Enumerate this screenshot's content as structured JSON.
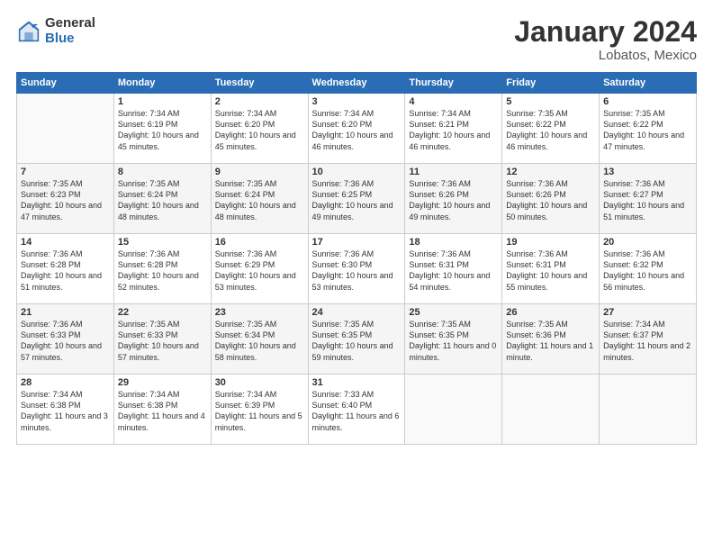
{
  "logo": {
    "general": "General",
    "blue": "Blue"
  },
  "title": "January 2024",
  "subtitle": "Lobatos, Mexico",
  "days_header": [
    "Sunday",
    "Monday",
    "Tuesday",
    "Wednesday",
    "Thursday",
    "Friday",
    "Saturday"
  ],
  "weeks": [
    [
      {
        "num": "",
        "sunrise": "",
        "sunset": "",
        "daylight": ""
      },
      {
        "num": "1",
        "sunrise": "Sunrise: 7:34 AM",
        "sunset": "Sunset: 6:19 PM",
        "daylight": "Daylight: 10 hours and 45 minutes."
      },
      {
        "num": "2",
        "sunrise": "Sunrise: 7:34 AM",
        "sunset": "Sunset: 6:20 PM",
        "daylight": "Daylight: 10 hours and 45 minutes."
      },
      {
        "num": "3",
        "sunrise": "Sunrise: 7:34 AM",
        "sunset": "Sunset: 6:20 PM",
        "daylight": "Daylight: 10 hours and 46 minutes."
      },
      {
        "num": "4",
        "sunrise": "Sunrise: 7:34 AM",
        "sunset": "Sunset: 6:21 PM",
        "daylight": "Daylight: 10 hours and 46 minutes."
      },
      {
        "num": "5",
        "sunrise": "Sunrise: 7:35 AM",
        "sunset": "Sunset: 6:22 PM",
        "daylight": "Daylight: 10 hours and 46 minutes."
      },
      {
        "num": "6",
        "sunrise": "Sunrise: 7:35 AM",
        "sunset": "Sunset: 6:22 PM",
        "daylight": "Daylight: 10 hours and 47 minutes."
      }
    ],
    [
      {
        "num": "7",
        "sunrise": "Sunrise: 7:35 AM",
        "sunset": "Sunset: 6:23 PM",
        "daylight": "Daylight: 10 hours and 47 minutes."
      },
      {
        "num": "8",
        "sunrise": "Sunrise: 7:35 AM",
        "sunset": "Sunset: 6:24 PM",
        "daylight": "Daylight: 10 hours and 48 minutes."
      },
      {
        "num": "9",
        "sunrise": "Sunrise: 7:35 AM",
        "sunset": "Sunset: 6:24 PM",
        "daylight": "Daylight: 10 hours and 48 minutes."
      },
      {
        "num": "10",
        "sunrise": "Sunrise: 7:36 AM",
        "sunset": "Sunset: 6:25 PM",
        "daylight": "Daylight: 10 hours and 49 minutes."
      },
      {
        "num": "11",
        "sunrise": "Sunrise: 7:36 AM",
        "sunset": "Sunset: 6:26 PM",
        "daylight": "Daylight: 10 hours and 49 minutes."
      },
      {
        "num": "12",
        "sunrise": "Sunrise: 7:36 AM",
        "sunset": "Sunset: 6:26 PM",
        "daylight": "Daylight: 10 hours and 50 minutes."
      },
      {
        "num": "13",
        "sunrise": "Sunrise: 7:36 AM",
        "sunset": "Sunset: 6:27 PM",
        "daylight": "Daylight: 10 hours and 51 minutes."
      }
    ],
    [
      {
        "num": "14",
        "sunrise": "Sunrise: 7:36 AM",
        "sunset": "Sunset: 6:28 PM",
        "daylight": "Daylight: 10 hours and 51 minutes."
      },
      {
        "num": "15",
        "sunrise": "Sunrise: 7:36 AM",
        "sunset": "Sunset: 6:28 PM",
        "daylight": "Daylight: 10 hours and 52 minutes."
      },
      {
        "num": "16",
        "sunrise": "Sunrise: 7:36 AM",
        "sunset": "Sunset: 6:29 PM",
        "daylight": "Daylight: 10 hours and 53 minutes."
      },
      {
        "num": "17",
        "sunrise": "Sunrise: 7:36 AM",
        "sunset": "Sunset: 6:30 PM",
        "daylight": "Daylight: 10 hours and 53 minutes."
      },
      {
        "num": "18",
        "sunrise": "Sunrise: 7:36 AM",
        "sunset": "Sunset: 6:31 PM",
        "daylight": "Daylight: 10 hours and 54 minutes."
      },
      {
        "num": "19",
        "sunrise": "Sunrise: 7:36 AM",
        "sunset": "Sunset: 6:31 PM",
        "daylight": "Daylight: 10 hours and 55 minutes."
      },
      {
        "num": "20",
        "sunrise": "Sunrise: 7:36 AM",
        "sunset": "Sunset: 6:32 PM",
        "daylight": "Daylight: 10 hours and 56 minutes."
      }
    ],
    [
      {
        "num": "21",
        "sunrise": "Sunrise: 7:36 AM",
        "sunset": "Sunset: 6:33 PM",
        "daylight": "Daylight: 10 hours and 57 minutes."
      },
      {
        "num": "22",
        "sunrise": "Sunrise: 7:35 AM",
        "sunset": "Sunset: 6:33 PM",
        "daylight": "Daylight: 10 hours and 57 minutes."
      },
      {
        "num": "23",
        "sunrise": "Sunrise: 7:35 AM",
        "sunset": "Sunset: 6:34 PM",
        "daylight": "Daylight: 10 hours and 58 minutes."
      },
      {
        "num": "24",
        "sunrise": "Sunrise: 7:35 AM",
        "sunset": "Sunset: 6:35 PM",
        "daylight": "Daylight: 10 hours and 59 minutes."
      },
      {
        "num": "25",
        "sunrise": "Sunrise: 7:35 AM",
        "sunset": "Sunset: 6:35 PM",
        "daylight": "Daylight: 11 hours and 0 minutes."
      },
      {
        "num": "26",
        "sunrise": "Sunrise: 7:35 AM",
        "sunset": "Sunset: 6:36 PM",
        "daylight": "Daylight: 11 hours and 1 minute."
      },
      {
        "num": "27",
        "sunrise": "Sunrise: 7:34 AM",
        "sunset": "Sunset: 6:37 PM",
        "daylight": "Daylight: 11 hours and 2 minutes."
      }
    ],
    [
      {
        "num": "28",
        "sunrise": "Sunrise: 7:34 AM",
        "sunset": "Sunset: 6:38 PM",
        "daylight": "Daylight: 11 hours and 3 minutes."
      },
      {
        "num": "29",
        "sunrise": "Sunrise: 7:34 AM",
        "sunset": "Sunset: 6:38 PM",
        "daylight": "Daylight: 11 hours and 4 minutes."
      },
      {
        "num": "30",
        "sunrise": "Sunrise: 7:34 AM",
        "sunset": "Sunset: 6:39 PM",
        "daylight": "Daylight: 11 hours and 5 minutes."
      },
      {
        "num": "31",
        "sunrise": "Sunrise: 7:33 AM",
        "sunset": "Sunset: 6:40 PM",
        "daylight": "Daylight: 11 hours and 6 minutes."
      },
      {
        "num": "",
        "sunrise": "",
        "sunset": "",
        "daylight": ""
      },
      {
        "num": "",
        "sunrise": "",
        "sunset": "",
        "daylight": ""
      },
      {
        "num": "",
        "sunrise": "",
        "sunset": "",
        "daylight": ""
      }
    ]
  ]
}
